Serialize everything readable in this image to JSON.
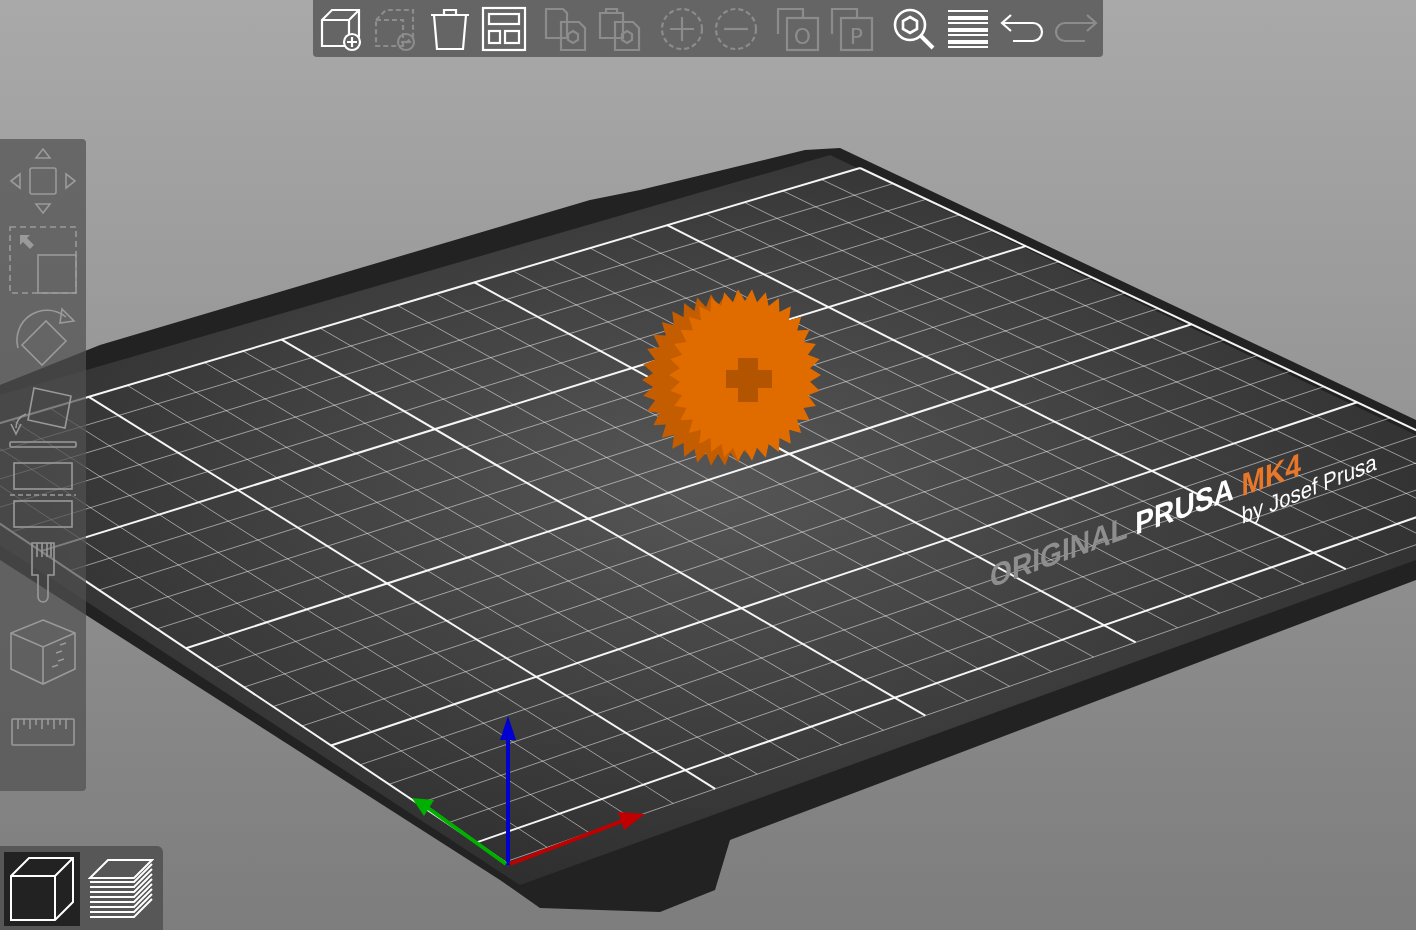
{
  "top_toolbar": [
    {
      "kind": "add",
      "disabled": false
    },
    {
      "kind": "delete",
      "disabled": true
    },
    {
      "kind": "delete_all",
      "disabled": false
    },
    {
      "kind": "arrange",
      "disabled": false
    },
    {
      "kind": "copy",
      "disabled": true
    },
    {
      "kind": "paste",
      "disabled": true
    },
    {
      "kind": "add_instance",
      "disabled": true
    },
    {
      "kind": "remove_instance",
      "disabled": true
    },
    {
      "kind": "split",
      "letter": "O",
      "disabled": true
    },
    {
      "kind": "split",
      "letter": "P",
      "disabled": true
    },
    {
      "kind": "search",
      "disabled": false
    },
    {
      "kind": "layers",
      "disabled": false
    },
    {
      "kind": "undo",
      "disabled": false
    },
    {
      "kind": "redo",
      "disabled": true
    }
  ],
  "left_toolbar": [
    {
      "kind": "move"
    },
    {
      "kind": "scale"
    },
    {
      "kind": "rotate"
    },
    {
      "kind": "place_on_face"
    },
    {
      "kind": "cut"
    },
    {
      "kind": "paint"
    },
    {
      "kind": "seam"
    },
    {
      "kind": "measure"
    }
  ],
  "bed_logo": {
    "prefix": "ORIGINAL",
    "brand": "PRUSA",
    "model": "MK4",
    "byline": "by Josef Prusa"
  },
  "view_toggle": [
    {
      "kind": "model",
      "selected": true
    },
    {
      "kind": "preview",
      "selected": false
    }
  ]
}
